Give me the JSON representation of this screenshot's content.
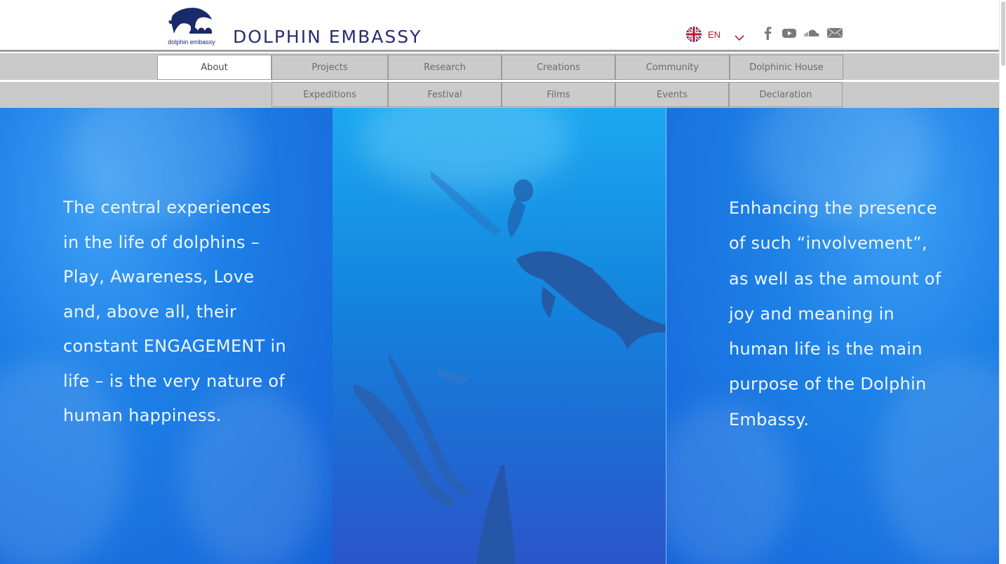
{
  "header": {
    "logo_text": "dolphin embassy",
    "site_title": "DOLPHIN EMBASSY",
    "language": {
      "code": "EN",
      "flag_icon": "uk-flag-icon"
    },
    "social_icons": [
      "facebook-icon",
      "youtube-icon",
      "soundcloud-icon",
      "mail-icon"
    ]
  },
  "nav": {
    "row1": [
      "About",
      "Projects",
      "Research",
      "Creations",
      "Community",
      "Dolphinic House"
    ],
    "row2": [
      "Expeditions",
      "Festival",
      "Films",
      "Events",
      "Declaration"
    ],
    "active": "About"
  },
  "hero": {
    "left_text": "The central experiences in the life of dolphins – Play, Awareness, Love and, above all, their constant ENGAGEMENT in life – is the very nature of human happiness.",
    "right_text": "Enhancing the presence of such “involvement”, as well as the amount of joy and meaning in human life is the main purpose of the Dolphin Embassy."
  },
  "colors": {
    "title": "#2a2d72",
    "nav_bg": "#c9c9c9",
    "lang_accent": "#b0202e",
    "hero_text": "#eef6ff"
  }
}
